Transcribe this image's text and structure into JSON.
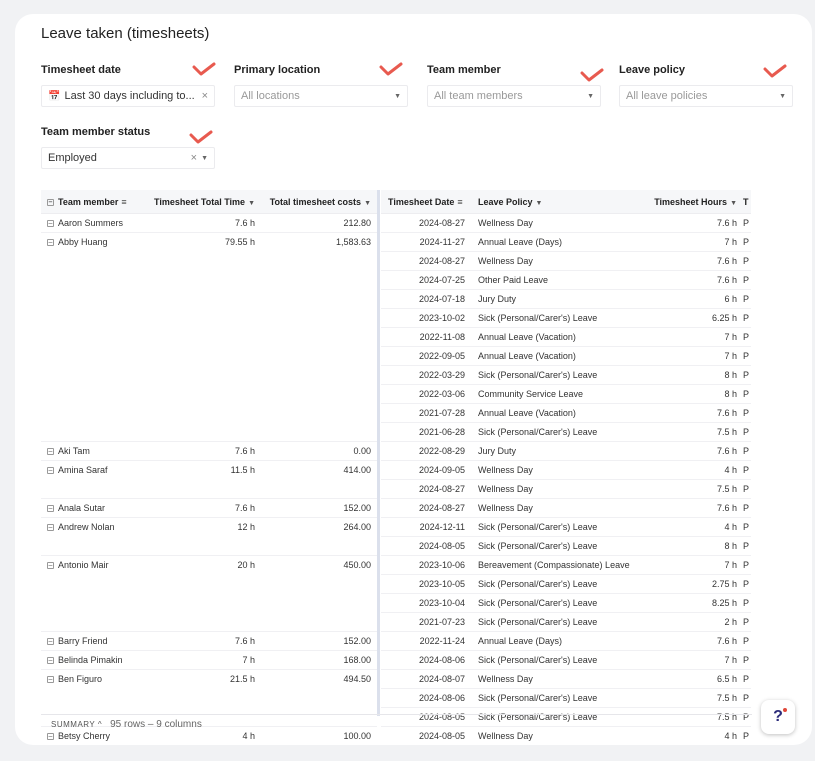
{
  "page": {
    "title": "Leave taken (timesheets)"
  },
  "accent": "#e85a4f",
  "filters": {
    "timesheet_date": {
      "label": "Timesheet date",
      "value": "Last 30 days including to..."
    },
    "primary_location": {
      "label": "Primary location",
      "placeholder": "All locations"
    },
    "team_member": {
      "label": "Team member",
      "placeholder": "All team members"
    },
    "leave_policy": {
      "label": "Leave policy",
      "placeholder": "All leave policies"
    },
    "team_member_status": {
      "label": "Team member status",
      "value": "Employed"
    }
  },
  "left_table": {
    "headers": [
      "Team member",
      "Timesheet Total Time",
      "Total timesheet costs"
    ],
    "rows": [
      {
        "name": "Aaron Summers",
        "time": "7.6 h",
        "cost": "212.80"
      },
      {
        "name": "Abby Huang",
        "time": "79.55 h",
        "cost": "1,583.63"
      },
      {
        "name": "",
        "time": "",
        "cost": ""
      },
      {
        "name": "",
        "time": "",
        "cost": ""
      },
      {
        "name": "",
        "time": "",
        "cost": ""
      },
      {
        "name": "",
        "time": "",
        "cost": ""
      },
      {
        "name": "",
        "time": "",
        "cost": ""
      },
      {
        "name": "",
        "time": "",
        "cost": ""
      },
      {
        "name": "",
        "time": "",
        "cost": ""
      },
      {
        "name": "",
        "time": "",
        "cost": ""
      },
      {
        "name": "",
        "time": "",
        "cost": ""
      },
      {
        "name": "",
        "time": "",
        "cost": ""
      },
      {
        "name": "Aki Tam",
        "time": "7.6 h",
        "cost": "0.00"
      },
      {
        "name": "Amina Saraf",
        "time": "11.5 h",
        "cost": "414.00"
      },
      {
        "name": "",
        "time": "",
        "cost": ""
      },
      {
        "name": "Anala Sutar",
        "time": "7.6 h",
        "cost": "152.00"
      },
      {
        "name": "Andrew Nolan",
        "time": "12 h",
        "cost": "264.00"
      },
      {
        "name": "",
        "time": "",
        "cost": ""
      },
      {
        "name": "Antonio Mair",
        "time": "20 h",
        "cost": "450.00"
      },
      {
        "name": "",
        "time": "",
        "cost": ""
      },
      {
        "name": "",
        "time": "",
        "cost": ""
      },
      {
        "name": "",
        "time": "",
        "cost": ""
      },
      {
        "name": "Barry Friend",
        "time": "7.6 h",
        "cost": "152.00"
      },
      {
        "name": "Belinda Pimakin",
        "time": "7 h",
        "cost": "168.00"
      },
      {
        "name": "Ben Figuro",
        "time": "21.5 h",
        "cost": "494.50"
      },
      {
        "name": "",
        "time": "",
        "cost": ""
      },
      {
        "name": "",
        "time": "",
        "cost": ""
      },
      {
        "name": "Betsy Cherry",
        "time": "4 h",
        "cost": "100.00"
      }
    ]
  },
  "right_table": {
    "headers": [
      "Timesheet Date",
      "Leave Policy",
      "Timesheet Hours",
      "T"
    ],
    "rows": [
      {
        "date": "2024-08-27",
        "policy": "Wellness Day",
        "hours": "7.6 h",
        "t": "P"
      },
      {
        "date": "2024-11-27",
        "policy": "Annual Leave (Days)",
        "hours": "7 h",
        "t": "P"
      },
      {
        "date": "2024-08-27",
        "policy": "Wellness Day",
        "hours": "7.6 h",
        "t": "P"
      },
      {
        "date": "2024-07-25",
        "policy": "Other Paid Leave",
        "hours": "7.6 h",
        "t": "P"
      },
      {
        "date": "2024-07-18",
        "policy": "Jury Duty",
        "hours": "6 h",
        "t": "P"
      },
      {
        "date": "2023-10-02",
        "policy": "Sick (Personal/Carer's) Leave",
        "hours": "6.25 h",
        "t": "P"
      },
      {
        "date": "2022-11-08",
        "policy": "Annual Leave (Vacation)",
        "hours": "7 h",
        "t": "P"
      },
      {
        "date": "2022-09-05",
        "policy": "Annual Leave (Vacation)",
        "hours": "7 h",
        "t": "P"
      },
      {
        "date": "2022-03-29",
        "policy": "Sick (Personal/Carer's) Leave",
        "hours": "8 h",
        "t": "P"
      },
      {
        "date": "2022-03-06",
        "policy": "Community Service Leave",
        "hours": "8 h",
        "t": "P"
      },
      {
        "date": "2021-07-28",
        "policy": "Annual Leave (Vacation)",
        "hours": "7.6 h",
        "t": "P"
      },
      {
        "date": "2021-06-28",
        "policy": "Sick (Personal/Carer's) Leave",
        "hours": "7.5 h",
        "t": "P"
      },
      {
        "date": "2022-08-29",
        "policy": "Jury Duty",
        "hours": "7.6 h",
        "t": "P"
      },
      {
        "date": "2024-09-05",
        "policy": "Wellness Day",
        "hours": "4 h",
        "t": "P"
      },
      {
        "date": "2024-08-27",
        "policy": "Wellness Day",
        "hours": "7.5 h",
        "t": "P"
      },
      {
        "date": "2024-08-27",
        "policy": "Wellness Day",
        "hours": "7.6 h",
        "t": "P"
      },
      {
        "date": "2024-12-11",
        "policy": "Sick (Personal/Carer's) Leave",
        "hours": "4 h",
        "t": "P"
      },
      {
        "date": "2024-08-05",
        "policy": "Sick (Personal/Carer's) Leave",
        "hours": "8 h",
        "t": "P"
      },
      {
        "date": "2023-10-06",
        "policy": "Bereavement (Compassionate) Leave",
        "hours": "7 h",
        "t": "P"
      },
      {
        "date": "2023-10-05",
        "policy": "Sick (Personal/Carer's) Leave",
        "hours": "2.75 h",
        "t": "P"
      },
      {
        "date": "2023-10-04",
        "policy": "Sick (Personal/Carer's) Leave",
        "hours": "8.25 h",
        "t": "P"
      },
      {
        "date": "2021-07-23",
        "policy": "Sick (Personal/Carer's) Leave",
        "hours": "2 h",
        "t": "P"
      },
      {
        "date": "2022-11-24",
        "policy": "Annual Leave (Days)",
        "hours": "7.6 h",
        "t": "P"
      },
      {
        "date": "2024-08-06",
        "policy": "Sick (Personal/Carer's) Leave",
        "hours": "7 h",
        "t": "P"
      },
      {
        "date": "2024-08-07",
        "policy": "Wellness Day",
        "hours": "6.5 h",
        "t": "P"
      },
      {
        "date": "2024-08-06",
        "policy": "Sick (Personal/Carer's) Leave",
        "hours": "7.5 h",
        "t": "P"
      },
      {
        "date": "2024-08-05",
        "policy": "Sick (Personal/Carer's) Leave",
        "hours": "7.5 h",
        "t": "P"
      },
      {
        "date": "2024-08-05",
        "policy": "Wellness Day",
        "hours": "4 h",
        "t": "P"
      }
    ]
  },
  "footer": {
    "summary_label": "SUMMARY",
    "summary_caret": "^",
    "stats": "95 rows – 9 columns"
  },
  "help": {
    "label": "?"
  }
}
